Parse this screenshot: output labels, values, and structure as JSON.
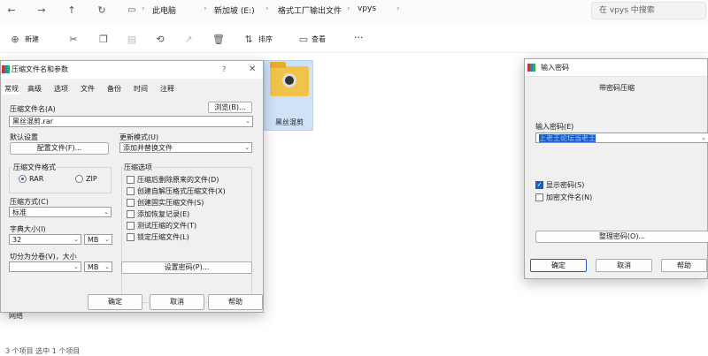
{
  "explorer": {
    "breadcrumb": [
      "此电脑",
      "新加坡 (E:)",
      "格式工厂输出文件",
      "vpys"
    ],
    "search_placeholder": "在 vpys 中搜索",
    "toolbar": {
      "new_label": "新建",
      "sort_label": "排序",
      "view_label": "查看",
      "more_label": "···"
    },
    "folder_name": "黑丝混剪",
    "nav_item": "网络",
    "status": "3 个项目    选中 1 个项目"
  },
  "compress_dialog": {
    "title": "压缩文件名和参数",
    "tabs": [
      "常规",
      "高级",
      "选项",
      "文件",
      "备份",
      "时间",
      "注释"
    ],
    "archive_name_label": "压缩文件名(A)",
    "archive_name_value": "黑丝混剪.rar",
    "browse_label": "浏览(B)...",
    "default_settings_label": "默认设置",
    "profiles_button": "配置文件(F)...",
    "update_mode_label": "更新模式(U)",
    "update_mode_value": "添加并替换文件",
    "format_label": "压缩文件格式",
    "format_rar": "RAR",
    "format_zip": "ZIP",
    "options_label": "压缩选项",
    "options": [
      "压缩后删除原来的文件(D)",
      "创建自解压格式压缩文件(X)",
      "创建固实压缩文件(S)",
      "添加恢复记录(E)",
      "测试压缩的文件(T)",
      "锁定压缩文件(L)"
    ],
    "method_label": "压缩方式(C)",
    "method_value": "标准",
    "dict_label": "字典大小(I)",
    "dict_value": "32",
    "dict_unit": "MB",
    "split_label": "切分为分卷(V)，大小",
    "split_value": "",
    "split_unit": "MB",
    "set_password_button": "设置密码(P)...",
    "ok": "确定",
    "cancel": "取消",
    "help": "帮助"
  },
  "password_dialog": {
    "title": "输入密码",
    "subtitle": "带密码压缩",
    "enter_label": "输入密码(E)",
    "password_value": "上老王论坛当老王",
    "show_password": "显示密码(S)",
    "encrypt_names": "加密文件名(N)",
    "organize_button": "整理密码(O)...",
    "ok": "确定",
    "cancel": "取消",
    "help": "帮助"
  }
}
